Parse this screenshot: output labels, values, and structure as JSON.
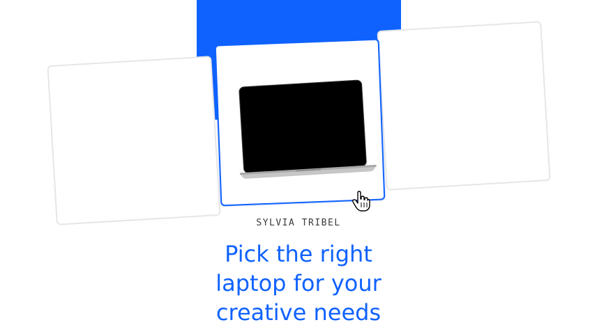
{
  "colors": {
    "accent": "#0f62fe",
    "card_border": "#e6e6e6",
    "screen": "#000000",
    "byline_text": "#393939"
  },
  "cards": [
    {
      "name": "left",
      "selected": false
    },
    {
      "name": "center",
      "selected": true,
      "image_icon": "laptop-icon"
    },
    {
      "name": "right",
      "selected": false
    }
  ],
  "cursor": {
    "icon": "hand-pointer-icon"
  },
  "article": {
    "author": "SYLVIA TRIBEL",
    "title_lines": [
      "Pick the right",
      "laptop for your",
      "creative needs"
    ]
  }
}
